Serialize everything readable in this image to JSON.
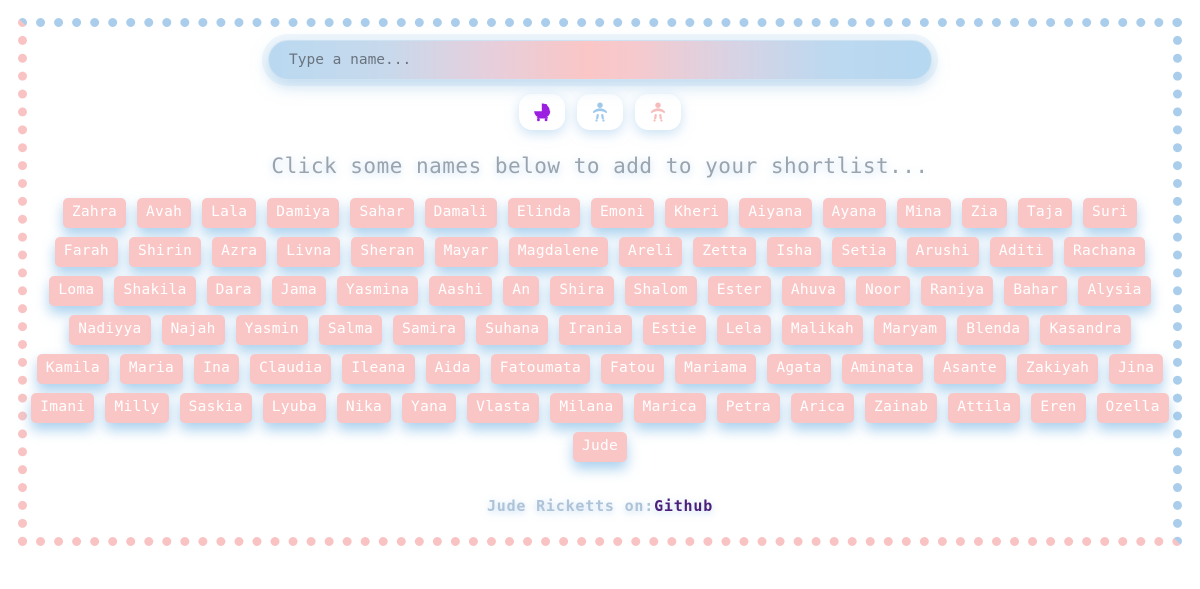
{
  "search": {
    "placeholder": "Type a name...",
    "value": ""
  },
  "toggles": [
    {
      "name": "both-genders-toggle",
      "icon": "baby-carriage-icon",
      "color": "#9b1fe0",
      "active": true
    },
    {
      "name": "boy-toggle",
      "icon": "baby-boy-icon",
      "color": "#9fc9ea",
      "active": false
    },
    {
      "name": "girl-toggle",
      "icon": "baby-girl-icon",
      "color": "#f7bcbc",
      "active": false
    }
  ],
  "heading": "Click some names below to add to your shortlist...",
  "names": [
    "Zahra",
    "Avah",
    "Lala",
    "Damiya",
    "Sahar",
    "Damali",
    "Elinda",
    "Emoni",
    "Kheri",
    "Aiyana",
    "Ayana",
    "Mina",
    "Zia",
    "Taja",
    "Suri",
    "Farah",
    "Shirin",
    "Azra",
    "Livna",
    "Sheran",
    "Mayar",
    "Magdalene",
    "Areli",
    "Zetta",
    "Isha",
    "Setia",
    "Arushi",
    "Aditi",
    "Rachana",
    "Loma",
    "Shakila",
    "Dara",
    "Jama",
    "Yasmina",
    "Aashi",
    "An",
    "Shira",
    "Shalom",
    "Ester",
    "Ahuva",
    "Noor",
    "Raniya",
    "Bahar",
    "Alysia",
    "Nadiyya",
    "Najah",
    "Yasmin",
    "Salma",
    "Samira",
    "Suhana",
    "Irania",
    "Estie",
    "Lela",
    "Malikah",
    "Maryam",
    "Blenda",
    "Kasandra",
    "Kamila",
    "Maria",
    "Ina",
    "Claudia",
    "Ileana",
    "Aida",
    "Fatoumata",
    "Fatou",
    "Mariama",
    "Agata",
    "Aminata",
    "Asante",
    "Zakiyah",
    "Jina",
    "Imani",
    "Milly",
    "Saskia",
    "Lyuba",
    "Nika",
    "Yana",
    "Vlasta",
    "Milana",
    "Marica",
    "Petra",
    "Arica",
    "Zainab",
    "Attila",
    "Eren",
    "Ozella",
    "Jude"
  ],
  "footer": {
    "author": "Jude Ricketts on:",
    "link_label": "Github"
  },
  "colors": {
    "tag_background": "#fac5c5",
    "tag_text": "#ffffff",
    "glow": "#96c6ea",
    "border_top": "#a9cdeb",
    "border_bottom": "#f9c3c3",
    "link": "#4b1f7a",
    "heading": "#9aa4ae"
  }
}
